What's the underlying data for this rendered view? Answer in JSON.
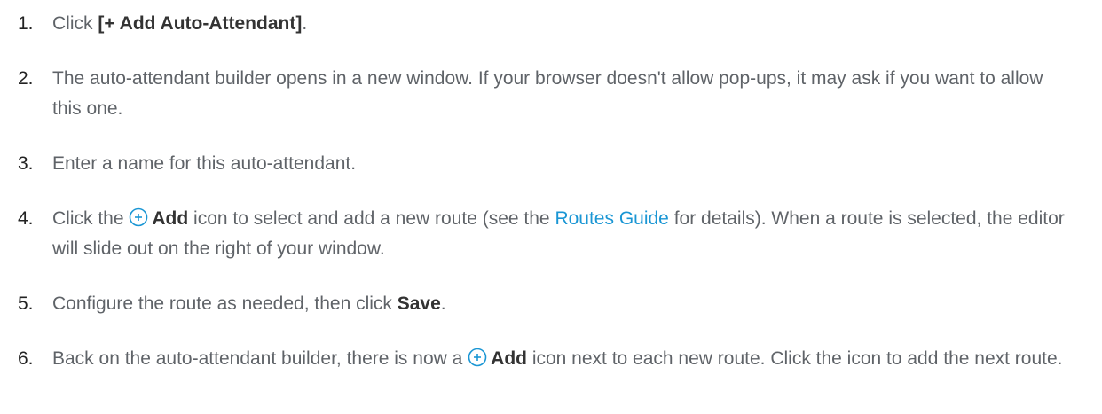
{
  "steps": [
    {
      "number": "1.",
      "pre": "Click ",
      "bold": "[+ Add Auto-Attendant]",
      "post": "."
    },
    {
      "number": "2.",
      "text": "The auto-attendant builder opens in a new window. If your browser doesn't allow pop-ups, it may ask if you want to allow this one."
    },
    {
      "number": "3.",
      "text": "Enter a name for this auto-attendant."
    },
    {
      "number": "4.",
      "pre": "Click the ",
      "icon": "add-circle-icon",
      "bold": "Add",
      "mid": " icon to select and add a new route (see the ",
      "link": "Routes Guide",
      "post": " for details). When a route is selected, the editor will slide out on the right of your window."
    },
    {
      "number": "5.",
      "pre": "Configure the route as needed, then click ",
      "bold": "Save",
      "post": "."
    },
    {
      "number": "6.",
      "pre": "Back on the auto-attendant builder, there is now a ",
      "icon": "add-circle-icon",
      "bold": "Add",
      "post": " icon next to each new route. Click the icon to add the next route."
    }
  ],
  "colors": {
    "text": "#5f6368",
    "number": "#222222",
    "link": "#1a96d4",
    "icon": "#1a96d4"
  }
}
